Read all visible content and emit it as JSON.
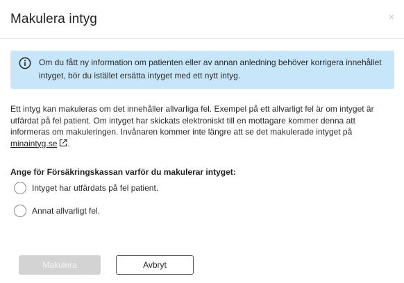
{
  "dialog": {
    "title": "Makulera intyg",
    "close_symbol": "×"
  },
  "info_banner": {
    "icon": "info-circle-icon",
    "text": "Om du fått ny information om patienten eller av annan anledning behöver korrigera innehållet intyget, bör du istället ersätta intyget med ett nytt intyg.",
    "background_color": "#c7e6f9"
  },
  "description": {
    "text_before_link": "Ett intyg kan makuleras om det innehåller allvarliga fel. Exempel på ett allvarligt fel är om intyget är utfärdat på fel patient. Om intyget har skickats elektroniskt till en mottagare kommer denna att informeras om makuleringen. Invånaren kommer inte längre att se det makulerade intyget på ",
    "link_text": "minaintyg.se",
    "link_icon": "external-link-icon",
    "text_after_link": "."
  },
  "question": "Ange för Försäkringskassan varför du makulerar intyget:",
  "options": [
    {
      "label": "Intyget har utfärdats på fel patient.",
      "selected": false
    },
    {
      "label": "Annat allvarligt fel.",
      "selected": false
    }
  ],
  "buttons": {
    "primary": {
      "label": "Makulera",
      "enabled": false
    },
    "secondary": {
      "label": "Avbryt",
      "enabled": true
    }
  }
}
